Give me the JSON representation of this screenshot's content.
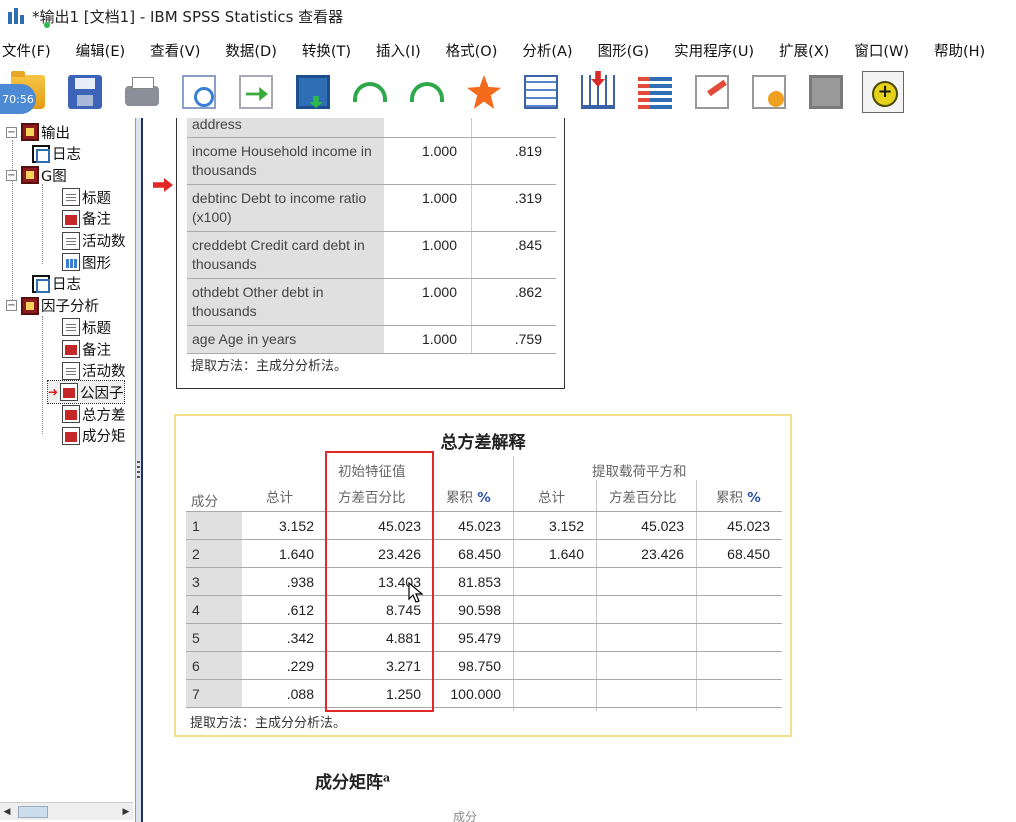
{
  "window": {
    "title": "*输出1 [文档1] - IBM SPSS Statistics 查看器"
  },
  "menu": [
    "文件(F)",
    "编辑(E)",
    "查看(V)",
    "数据(D)",
    "转换(T)",
    "插入(I)",
    "格式(O)",
    "分析(A)",
    "图形(G)",
    "实用程序(U)",
    "扩展(X)",
    "窗口(W)",
    "帮助(H)"
  ],
  "toolbar": {
    "icons": [
      "open-folder-icon",
      "save-icon",
      "print-icon",
      "print-preview-icon",
      "export-icon",
      "goto-data-icon",
      "undo-icon",
      "redo-icon",
      "goto-case-icon",
      "goto-variable-icon",
      "insert-cases-icon",
      "variables-icon",
      "edit-doc-icon",
      "run-script-icon",
      "disabled-icon",
      "designate-window-icon"
    ]
  },
  "overlay": {
    "time": "70:56"
  },
  "tree": {
    "items": [
      {
        "label": "输出",
        "icon": "book",
        "level": 0,
        "expander": "-"
      },
      {
        "label": "日志",
        "icon": "log",
        "level": 1
      },
      {
        "label": "G图",
        "icon": "book",
        "level": 0,
        "expander": "-"
      },
      {
        "label": "标题",
        "icon": "page",
        "level": 2
      },
      {
        "label": "备注",
        "icon": "table",
        "level": 2
      },
      {
        "label": "活动数",
        "icon": "page",
        "level": 2
      },
      {
        "label": "图形",
        "icon": "chart",
        "level": 2
      },
      {
        "label": "日志",
        "icon": "log",
        "level": 1
      },
      {
        "label": "因子分析",
        "icon": "book",
        "level": 0,
        "expander": "-"
      },
      {
        "label": "标题",
        "icon": "page",
        "level": 2
      },
      {
        "label": "备注",
        "icon": "table",
        "level": 2
      },
      {
        "label": "活动数",
        "icon": "page",
        "level": 2
      },
      {
        "label": "公因子",
        "icon": "table",
        "level": 2,
        "selected": true
      },
      {
        "label": "总方差",
        "icon": "table",
        "level": 2
      },
      {
        "label": "成分矩",
        "icon": "table",
        "level": 2
      }
    ]
  },
  "communalities": {
    "rows": [
      {
        "label": "address",
        "initial": "",
        "extraction": ""
      },
      {
        "label": "income Household income in thousands",
        "initial": "1.000",
        "extraction": ".819"
      },
      {
        "label": "debtinc Debt to income ratio (x100)",
        "initial": "1.000",
        "extraction": ".319"
      },
      {
        "label": "creddebt Credit card debt in thousands",
        "initial": "1.000",
        "extraction": ".845"
      },
      {
        "label": "othdebt Other debt in thousands",
        "initial": "1.000",
        "extraction": ".862"
      },
      {
        "label": "age Age in years",
        "initial": "1.000",
        "extraction": ".759"
      }
    ],
    "footnote": "提取方法：主成分分析法。"
  },
  "variance": {
    "title": "总方差解释",
    "group_initial": "初始特征值",
    "group_extraction": "提取载荷平方和",
    "col_component": "成分",
    "col_total": "总计",
    "col_pct_var": "方差百分比",
    "col_cum": "累积 ",
    "col_cum_pct": "%",
    "rows": [
      {
        "c": "1",
        "t": "3.152",
        "p": "45.023",
        "cum": "45.023",
        "et": "3.152",
        "ep": "45.023",
        "ecum": "45.023"
      },
      {
        "c": "2",
        "t": "1.640",
        "p": "23.426",
        "cum": "68.450",
        "et": "1.640",
        "ep": "23.426",
        "ecum": "68.450"
      },
      {
        "c": "3",
        "t": ".938",
        "p": "13.403",
        "cum": "81.853",
        "et": "",
        "ep": "",
        "ecum": ""
      },
      {
        "c": "4",
        "t": ".612",
        "p": "8.745",
        "cum": "90.598",
        "et": "",
        "ep": "",
        "ecum": ""
      },
      {
        "c": "5",
        "t": ".342",
        "p": "4.881",
        "cum": "95.479",
        "et": "",
        "ep": "",
        "ecum": ""
      },
      {
        "c": "6",
        "t": ".229",
        "p": "3.271",
        "cum": "98.750",
        "et": "",
        "ep": "",
        "ecum": ""
      },
      {
        "c": "7",
        "t": ".088",
        "p": "1.250",
        "cum": "100.000",
        "et": "",
        "ep": "",
        "ecum": ""
      }
    ],
    "footnote": "提取方法：主成分分析法。"
  },
  "matrix": {
    "title": "成分矩阵",
    "sup": "a",
    "sub": "成分"
  }
}
